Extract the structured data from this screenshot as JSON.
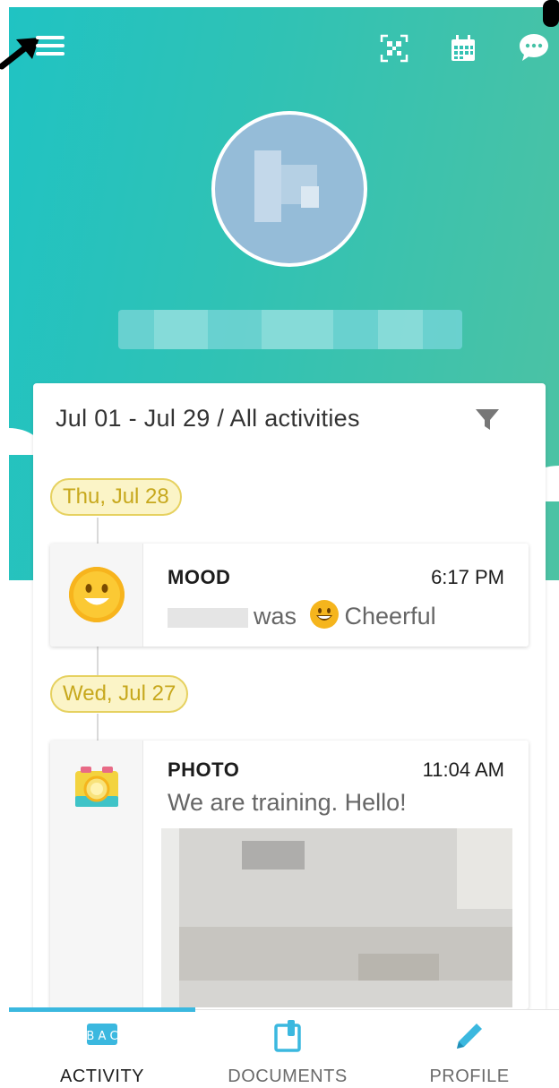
{
  "header": {
    "menu_icon": "hamburger-menu-icon",
    "actions": [
      {
        "icon": "qr-code-icon"
      },
      {
        "icon": "calendar-icon"
      },
      {
        "icon": "chat-bubble-icon"
      }
    ],
    "gradient_colors": [
      "#20c3c3",
      "#4dc2a3"
    ]
  },
  "feed": {
    "filter_label": "Jul 01 - Jul 29 / All activities",
    "filter_icon": "filter-funnel-icon",
    "groups": [
      {
        "date": "Thu, Jul 28",
        "entries": [
          {
            "type": "MOOD",
            "time": "6:17 PM",
            "text_before": "was",
            "mood_label": "Cheerful",
            "icon": "smiley-face-icon"
          }
        ]
      },
      {
        "date": "Wed, Jul 27",
        "entries": [
          {
            "type": "PHOTO",
            "time": "11:04 AM",
            "caption": "We are training. Hello!",
            "icon": "camera-icon"
          }
        ]
      }
    ]
  },
  "bottom_nav": {
    "items": [
      {
        "label": "ACTIVITY",
        "icon": "abc-blocks-icon",
        "active": true
      },
      {
        "label": "DOCUMENTS",
        "icon": "document-clip-icon",
        "active": false
      },
      {
        "label": "PROFILE",
        "icon": "pencil-icon",
        "active": false
      }
    ],
    "accent_color": "#3bb8df"
  },
  "colors": {
    "date_pill_border": "#e6d160",
    "date_pill_text": "#c7a81d"
  }
}
